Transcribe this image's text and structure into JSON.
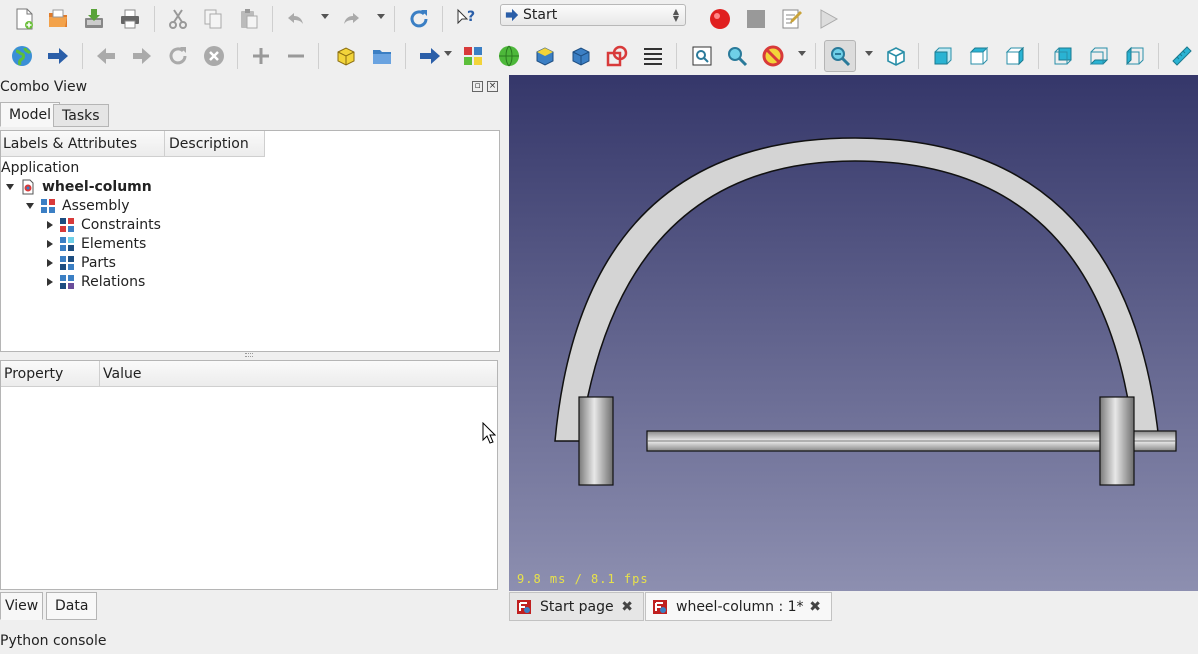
{
  "toolbar": {
    "workbench_selected": "Start"
  },
  "combo_view": {
    "title": "Combo View",
    "tabs": [
      "Model",
      "Tasks"
    ],
    "tree_columns": [
      "Labels & Attributes",
      "Description"
    ],
    "tree": {
      "root": "Application",
      "document": "wheel-column",
      "assembly": "Assembly",
      "children": [
        "Constraints",
        "Elements",
        "Parts",
        "Relations"
      ]
    },
    "property_columns": [
      "Property",
      "Value"
    ],
    "bottom_tabs": [
      "View",
      "Data"
    ]
  },
  "viewer": {
    "fps_text": "9.8 ms / 8.1 fps"
  },
  "doc_tabs": [
    {
      "label": "Start page"
    },
    {
      "label": "wheel-column : 1*"
    }
  ],
  "python_console": "Python console",
  "colors": {
    "viewer_top": "#35376a",
    "viewer_bottom": "#8d8fb0",
    "fps_text": "#e8e24a",
    "record_red": "#e02020"
  }
}
